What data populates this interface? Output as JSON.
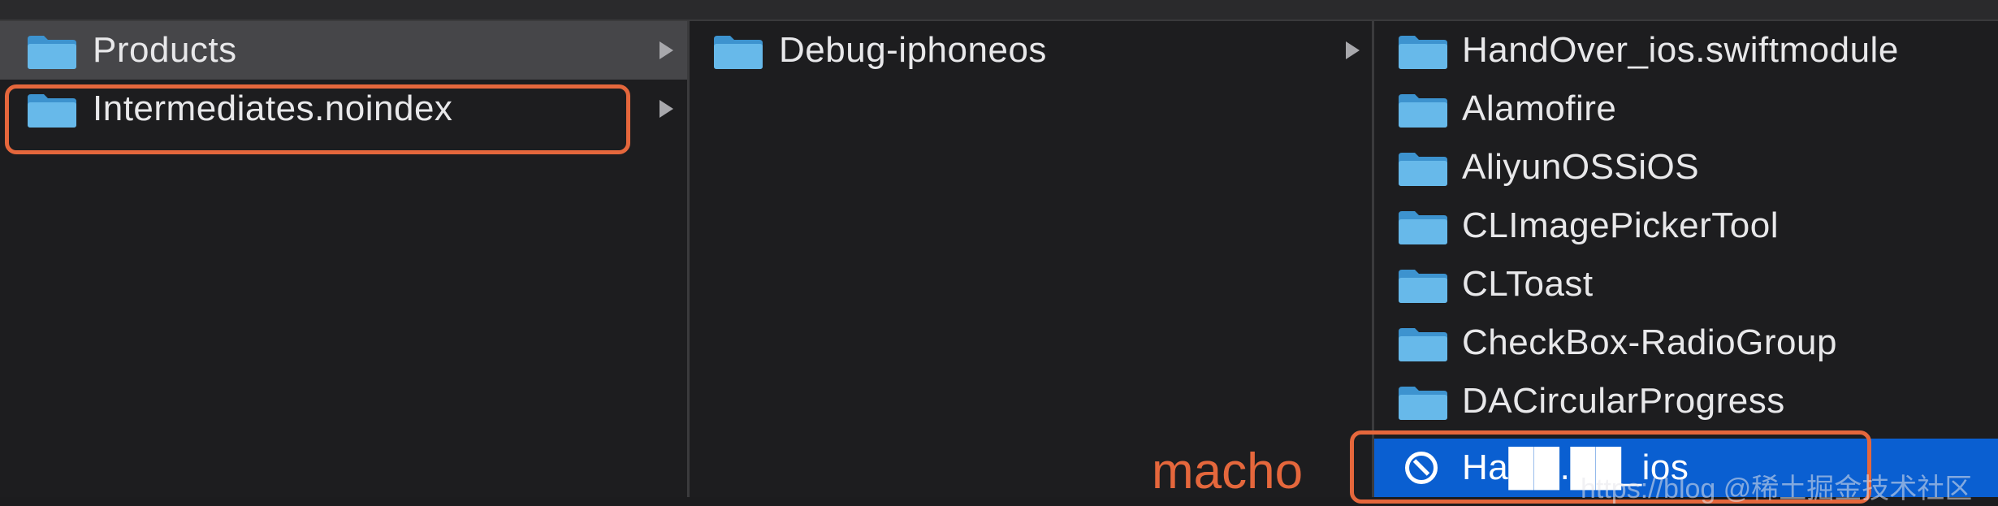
{
  "columns": [
    {
      "items": [
        {
          "label": "Products",
          "icon": "folder-icon",
          "has_children": true,
          "selected": "inactive"
        },
        {
          "label": "Intermediates.noindex",
          "icon": "folder-icon",
          "has_children": true,
          "selected": "none"
        }
      ]
    },
    {
      "items": [
        {
          "label": "Debug-iphoneos",
          "icon": "folder-icon",
          "has_children": true,
          "selected": "none"
        }
      ]
    },
    {
      "items": [
        {
          "label": "HandOver_ios.swiftmodule",
          "icon": "folder-icon"
        },
        {
          "label": "Alamofire",
          "icon": "folder-icon"
        },
        {
          "label": "AliyunOSSiOS",
          "icon": "folder-icon"
        },
        {
          "label": "CLImagePickerTool",
          "icon": "folder-icon"
        },
        {
          "label": "CLToast",
          "icon": "folder-icon"
        },
        {
          "label": "CheckBox-RadioGroup",
          "icon": "folder-icon"
        },
        {
          "label": "DACircularProgress",
          "icon": "folder-icon"
        },
        {
          "label": "Ha██.██_ios",
          "icon": "no-entry-icon",
          "selected": "active"
        }
      ]
    }
  ],
  "annotations": {
    "macho_label": "macho"
  },
  "watermark": "https://blog @稀土掘金技术社区",
  "colors": {
    "annotation": "#e5673c",
    "selection_active": "#0a5fd1",
    "selection_inactive": "#464649",
    "folder_blue": "#5fb3e6"
  }
}
